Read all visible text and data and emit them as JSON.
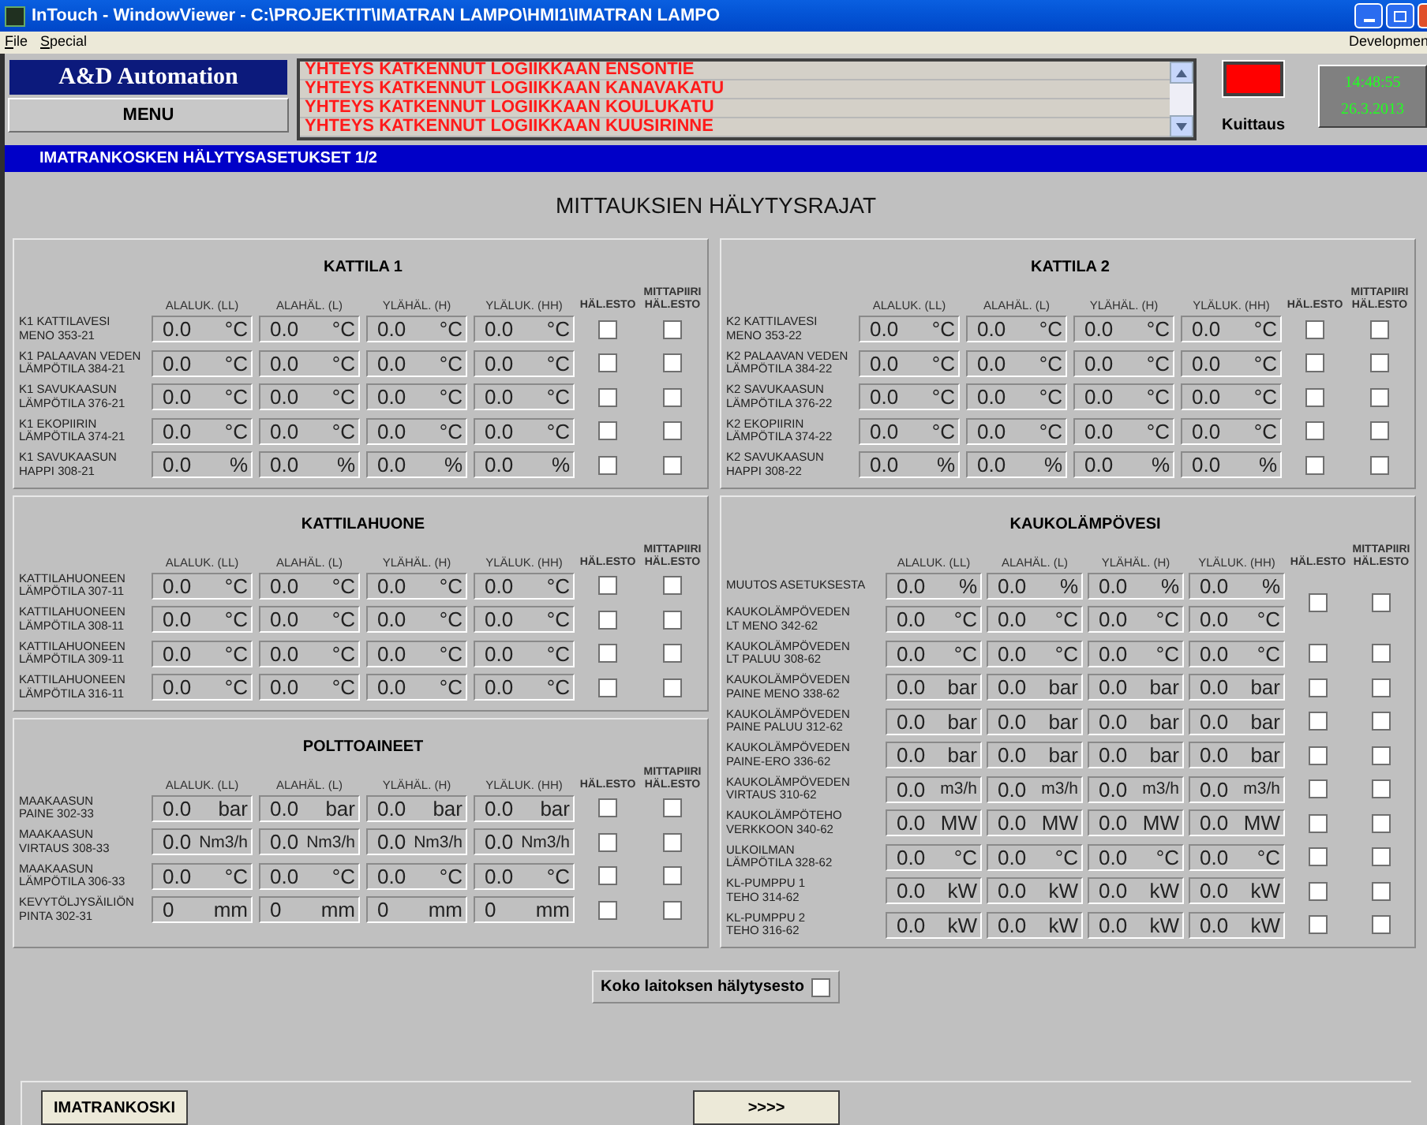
{
  "window": {
    "title": "InTouch - WindowViewer - C:\\PROJEKTIT\\IMATRAN LAMPO\\HMI1\\IMATRAN LAMPO"
  },
  "menu": [
    "File",
    "Special"
  ],
  "menu_right": "Developmen",
  "header": {
    "logo": "A&D Automation",
    "menu_button": "MENU",
    "alarms": [
      "YHTEYS KATKENNUT LOGIIKKAAN ENSONTIE",
      "YHTEYS KATKENNUT LOGIIKKAAN KANAVAKATU",
      "YHTEYS KATKENNUT LOGIIKKAAN KOULUKATU",
      "YHTEYS KATKENNUT LOGIIKKAAN KUUSIRINNE"
    ],
    "alarm_active": true,
    "ack_label": "Kuittaus",
    "time": "14:48:55",
    "date": "26.3.2013"
  },
  "page_title": "IMATRANKOSKEN HÄLYTYSASETUKSET 1/2",
  "heading": "MITTAUKSIEN HÄLYTYSRAJAT",
  "columns": [
    {
      "panels": [
        {
          "title": "KATTILA 1",
          "kind": "standard",
          "headers": [
            "ALALUK. (LL)",
            "ALAHÄL. (L)",
            "YLÄHÄL. (H)",
            "YLÄLUK. (HH)",
            "HÄL.ESTO",
            "MITTAPIIRI\nHÄL.ESTO"
          ],
          "rows": [
            {
              "label": "K1 KATTILAVESI\nMENO 353-21",
              "values": [
                "0.0",
                "0.0",
                "0.0",
                "0.0"
              ],
              "units": [
                "°C",
                "°C",
                "°C",
                "°C"
              ],
              "hal_esto": false,
              "mittapiiri_esto": false
            },
            {
              "label": "K1 PALAAVAN VEDEN\nLÄMPÖTILA 384-21",
              "values": [
                "0.0",
                "0.0",
                "0.0",
                "0.0"
              ],
              "units": [
                "°C",
                "°C",
                "°C",
                "°C"
              ],
              "hal_esto": false,
              "mittapiiri_esto": false
            },
            {
              "label": "K1 SAVUKAASUN\nLÄMPÖTILA 376-21",
              "values": [
                "0.0",
                "0.0",
                "0.0",
                "0.0"
              ],
              "units": [
                "°C",
                "°C",
                "°C",
                "°C"
              ],
              "hal_esto": false,
              "mittapiiri_esto": false
            },
            {
              "label": "K1 EKOPIIRIN\nLÄMPÖTILA 374-21",
              "values": [
                "0.0",
                "0.0",
                "0.0",
                "0.0"
              ],
              "units": [
                "°C",
                "°C",
                "°C",
                "°C"
              ],
              "hal_esto": false,
              "mittapiiri_esto": false
            },
            {
              "label": "K1 SAVUKAASUN\nHAPPI 308-21",
              "values": [
                "0.0",
                "0.0",
                "0.0",
                "0.0"
              ],
              "units": [
                "%",
                "%",
                "%",
                "%"
              ],
              "hal_esto": false,
              "mittapiiri_esto": false
            }
          ]
        },
        {
          "title": "KATTILAHUONE",
          "kind": "standard",
          "headers": [
            "ALALUK. (LL)",
            "ALAHÄL. (L)",
            "YLÄHÄL. (H)",
            "YLÄLUK. (HH)",
            "HÄL.ESTO",
            "MITTAPIIRI\nHÄL.ESTO"
          ],
          "rows": [
            {
              "label": "KATTILAHUONEEN\nLÄMPÖTILA 307-11",
              "values": [
                "0.0",
                "0.0",
                "0.0",
                "0.0"
              ],
              "units": [
                "°C",
                "°C",
                "°C",
                "°C"
              ],
              "hal_esto": false,
              "mittapiiri_esto": false
            },
            {
              "label": "KATTILAHUONEEN\nLÄMPÖTILA 308-11",
              "values": [
                "0.0",
                "0.0",
                "0.0",
                "0.0"
              ],
              "units": [
                "°C",
                "°C",
                "°C",
                "°C"
              ],
              "hal_esto": false,
              "mittapiiri_esto": false
            },
            {
              "label": "KATTILAHUONEEN\nLÄMPÖTILA 309-11",
              "values": [
                "0.0",
                "0.0",
                "0.0",
                "0.0"
              ],
              "units": [
                "°C",
                "°C",
                "°C",
                "°C"
              ],
              "hal_esto": false,
              "mittapiiri_esto": false
            },
            {
              "label": "KATTILAHUONEEN\nLÄMPÖTILA 316-11",
              "values": [
                "0.0",
                "0.0",
                "0.0",
                "0.0"
              ],
              "units": [
                "°C",
                "°C",
                "°C",
                "°C"
              ],
              "hal_esto": false,
              "mittapiiri_esto": false
            }
          ]
        },
        {
          "title": "POLTTOAINEET",
          "kind": "standard",
          "headers": [
            "ALALUK. (LL)",
            "ALAHÄL. (L)",
            "YLÄHÄL. (H)",
            "YLÄLUK. (HH)",
            "HÄL.ESTO",
            "MITTAPIIRI\nHÄL.ESTO"
          ],
          "rows": [
            {
              "label": "MAAKAASUN\nPAINE 302-33",
              "values": [
                "0.0",
                "0.0",
                "0.0",
                "0.0"
              ],
              "units": [
                "bar",
                "bar",
                "bar",
                "bar"
              ],
              "hal_esto": false,
              "mittapiiri_esto": false
            },
            {
              "label": "MAAKAASUN\nVIRTAUS 308-33",
              "values": [
                "0.0",
                "0.0",
                "0.0",
                "0.0"
              ],
              "units": [
                "Nm3/h",
                "Nm3/h",
                "Nm3/h",
                "Nm3/h"
              ],
              "hal_esto": false,
              "mittapiiri_esto": false
            },
            {
              "label": "MAAKAASUN\nLÄMPÖTILA 306-33",
              "values": [
                "0.0",
                "0.0",
                "0.0",
                "0.0"
              ],
              "units": [
                "°C",
                "°C",
                "°C",
                "°C"
              ],
              "hal_esto": false,
              "mittapiiri_esto": false
            },
            {
              "label": "KEVYTÖLJYSÄILIÖN\nPINTA 302-31",
              "values": [
                "0",
                "0",
                "0",
                "0"
              ],
              "units": [
                "mm",
                "mm",
                "mm",
                "mm"
              ],
              "hal_esto": false,
              "mittapiiri_esto": false
            }
          ]
        }
      ]
    },
    {
      "panels": [
        {
          "title": "KATTILA 2",
          "kind": "standard",
          "headers": [
            "ALALUK. (LL)",
            "ALAHÄL. (L)",
            "YLÄHÄL. (H)",
            "YLÄLUK. (HH)",
            "HÄL.ESTO",
            "MITTAPIIRI\nHÄL.ESTO"
          ],
          "rows": [
            {
              "label": "K2 KATTILAVESI\nMENO 353-22",
              "values": [
                "0.0",
                "0.0",
                "0.0",
                "0.0"
              ],
              "units": [
                "°C",
                "°C",
                "°C",
                "°C"
              ],
              "hal_esto": false,
              "mittapiiri_esto": false
            },
            {
              "label": "K2 PALAAVAN VEDEN\nLÄMPÖTILA 384-22",
              "values": [
                "0.0",
                "0.0",
                "0.0",
                "0.0"
              ],
              "units": [
                "°C",
                "°C",
                "°C",
                "°C"
              ],
              "hal_esto": false,
              "mittapiiri_esto": false
            },
            {
              "label": "K2 SAVUKAASUN\nLÄMPÖTILA 376-22",
              "values": [
                "0.0",
                "0.0",
                "0.0",
                "0.0"
              ],
              "units": [
                "°C",
                "°C",
                "°C",
                "°C"
              ],
              "hal_esto": false,
              "mittapiiri_esto": false
            },
            {
              "label": "K2 EKOPIIRIN\nLÄMPÖTILA 374-22",
              "values": [
                "0.0",
                "0.0",
                "0.0",
                "0.0"
              ],
              "units": [
                "°C",
                "°C",
                "°C",
                "°C"
              ],
              "hal_esto": false,
              "mittapiiri_esto": false
            },
            {
              "label": "K2 SAVUKAASUN\nHAPPI 308-22",
              "values": [
                "0.0",
                "0.0",
                "0.0",
                "0.0"
              ],
              "units": [
                "%",
                "%",
                "%",
                "%"
              ],
              "hal_esto": false,
              "mittapiiri_esto": false
            }
          ]
        },
        {
          "title": "KAUKOLÄMPÖVESI",
          "kind": "wide",
          "headers": [
            "ALALUK. (LL)",
            "ALAHÄL. (L)",
            "YLÄHÄL. (H)",
            "YLÄLUK. (HH)",
            "HÄL.ESTO",
            "MITTAPIIRI\nHÄL.ESTO"
          ],
          "rows": [
            {
              "label": "MUUTOS ASETUKSESTA",
              "values": [
                "0.0",
                "0.0",
                "0.0",
                "0.0"
              ],
              "units": [
                "%",
                "%",
                "%",
                "%"
              ],
              "hal_esto": false,
              "mittapiiri_esto": false
            },
            {
              "label": "KAUKOLÄMPÖVEDEN\nLT MENO 342-62",
              "values": [
                "0.0",
                "0.0",
                "0.0",
                "0.0"
              ],
              "units": [
                "°C",
                "°C",
                "°C",
                "°C"
              ]
            },
            {
              "label": "KAUKOLÄMPÖVEDEN\nLT PALUU 308-62",
              "values": [
                "0.0",
                "0.0",
                "0.0",
                "0.0"
              ],
              "units": [
                "°C",
                "°C",
                "°C",
                "°C"
              ],
              "hal_esto": false,
              "mittapiiri_esto": false
            },
            {
              "label": "KAUKOLÄMPÖVEDEN\nPAINE MENO 338-62",
              "values": [
                "0.0",
                "0.0",
                "0.0",
                "0.0"
              ],
              "units": [
                "bar",
                "bar",
                "bar",
                "bar"
              ],
              "hal_esto": false,
              "mittapiiri_esto": false
            },
            {
              "label": "KAUKOLÄMPÖVEDEN\nPAINE PALUU 312-62",
              "values": [
                "0.0",
                "0.0",
                "0.0",
                "0.0"
              ],
              "units": [
                "bar",
                "bar",
                "bar",
                "bar"
              ],
              "hal_esto": false,
              "mittapiiri_esto": false
            },
            {
              "label": "KAUKOLÄMPÖVEDEN\nPAINE-ERO 336-62",
              "values": [
                "0.0",
                "0.0",
                "0.0",
                "0.0"
              ],
              "units": [
                "bar",
                "bar",
                "bar",
                "bar"
              ],
              "hal_esto": false,
              "mittapiiri_esto": false
            },
            {
              "label": "KAUKOLÄMPÖVEDEN\nVIRTAUS 310-62",
              "values": [
                "0.0",
                "0.0",
                "0.0",
                "0.0"
              ],
              "units": [
                "m3/h",
                "m3/h",
                "m3/h",
                "m3/h"
              ],
              "hal_esto": false,
              "mittapiiri_esto": false
            },
            {
              "label": "KAUKOLÄMPÖTEHO\nVERKKOON 340-62",
              "values": [
                "0.0",
                "0.0",
                "0.0",
                "0.0"
              ],
              "units": [
                "MW",
                "MW",
                "MW",
                "MW"
              ],
              "hal_esto": false,
              "mittapiiri_esto": false
            },
            {
              "label": "ULKOILMAN\nLÄMPÖTILA 328-62",
              "values": [
                "0.0",
                "0.0",
                "0.0",
                "0.0"
              ],
              "units": [
                "°C",
                "°C",
                "°C",
                "°C"
              ],
              "hal_esto": false,
              "mittapiiri_esto": false
            },
            {
              "label": "KL-PUMPPU 1\nTEHO 314-62",
              "values": [
                "0.0",
                "0.0",
                "0.0",
                "0.0"
              ],
              "units": [
                "kW",
                "kW",
                "kW",
                "kW"
              ],
              "hal_esto": false,
              "mittapiiri_esto": false
            },
            {
              "label": "KL-PUMPPU 2\nTEHO 316-62",
              "values": [
                "0.0",
                "0.0",
                "0.0",
                "0.0"
              ],
              "units": [
                "kW",
                "kW",
                "kW",
                "kW"
              ],
              "hal_esto": false,
              "mittapiiri_esto": false
            }
          ]
        }
      ]
    }
  ],
  "plant_block": {
    "label": "Koko laitoksen hälytysesto",
    "checked": false
  },
  "footer_buttons": [
    "IMATRANKOSKI",
    ">>>>"
  ]
}
